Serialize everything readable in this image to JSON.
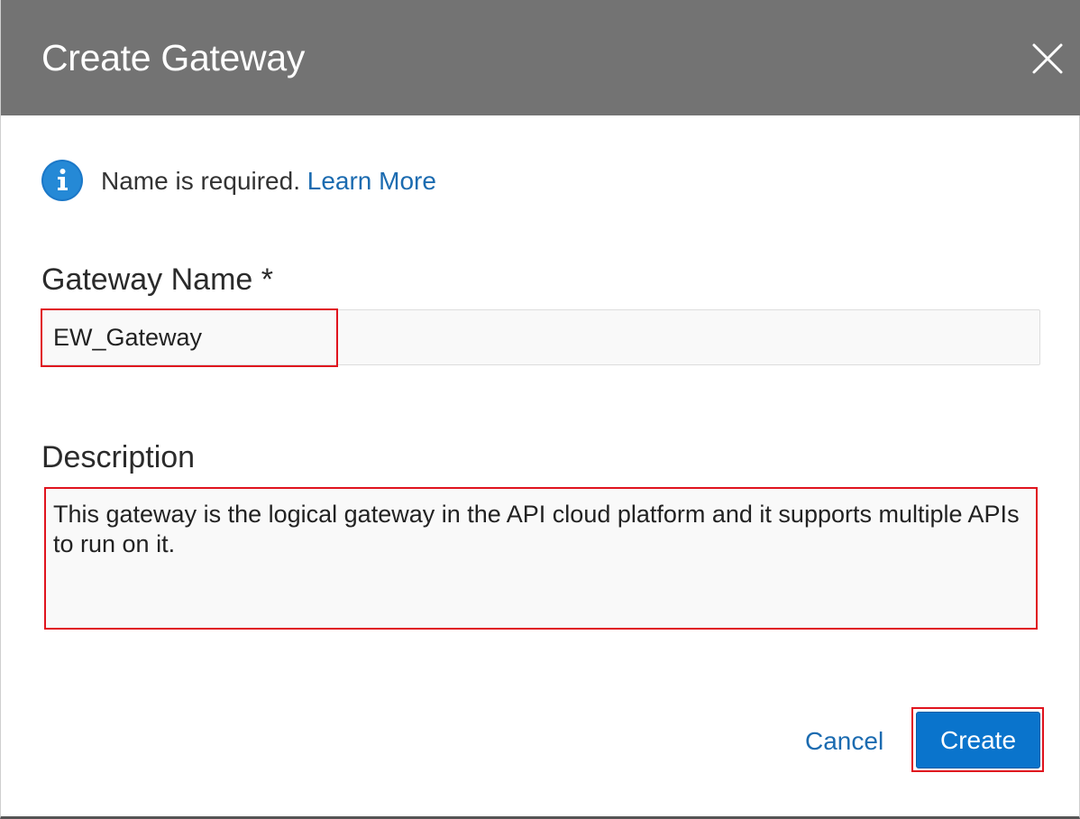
{
  "dialog": {
    "title": "Create Gateway",
    "close_icon": "close-icon"
  },
  "info": {
    "icon": "info-icon",
    "accent_color": "#1b78c8",
    "text": "Name is required. ",
    "link_text": "Learn More"
  },
  "form": {
    "name_label": "Gateway Name *",
    "name_value": "EW_Gateway",
    "description_label": "Description",
    "description_value": "This gateway is the logical gateway in the API cloud platform and it supports multiple APIs to run on it."
  },
  "actions": {
    "cancel_label": "Cancel",
    "create_label": "Create",
    "primary_color": "#0a74cc",
    "highlight_color": "#e0141e"
  }
}
